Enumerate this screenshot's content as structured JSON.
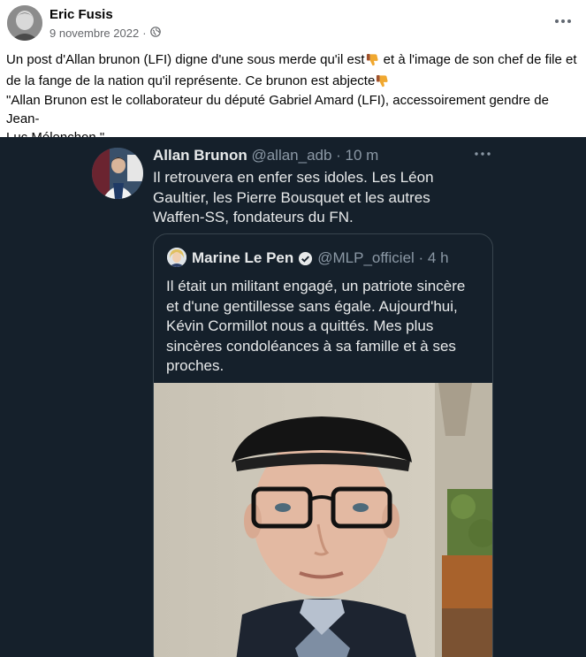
{
  "post": {
    "author": "Eric Fusis",
    "date": "9 novembre 2022",
    "separator": "·",
    "more_label": "···",
    "para1_a": "Un post d'Allan brunon (LFI) digne d'une sous merde qu'il est",
    "para1_b": "  et à l'image de son chef de file et",
    "para1_c": "de la fange de la nation qu'il  représente. Ce brunon est abjecte",
    "para2_a": "\"Allan Brunon est le collaborateur du député Gabriel Amard (LFI), accessoirement gendre de Jean-",
    "para2_b": "Luc Mélenchon.\"",
    "emoji": "thumbs-down"
  },
  "tweet": {
    "name": "Allan Brunon",
    "handle": "@allan_adb · 10 m",
    "lines": [
      "Il retrouvera en enfer ses idoles. Les Léon",
      "Gaultier, les Pierre Bousquet et les autres",
      "Waffen-SS, fondateurs du FN."
    ],
    "more_label": "···",
    "quote": {
      "name": "Marine Le Pen",
      "handle": "@MLP_officiel · 4 h",
      "lines": [
        "Il était un militant engagé, un patriote sincère",
        "et d'une gentillesse sans égale. Aujourd'hui,",
        "Kévin Cormillot nous a quittés. Mes plus",
        "sincères condoléances à sa famille et à ses",
        "proches."
      ]
    }
  },
  "colors": {
    "tweet_bg": "#15202b",
    "tweet_text": "#e7e9ea",
    "tweet_secondary": "#8b98a5",
    "fb_secondary": "#65676b"
  }
}
